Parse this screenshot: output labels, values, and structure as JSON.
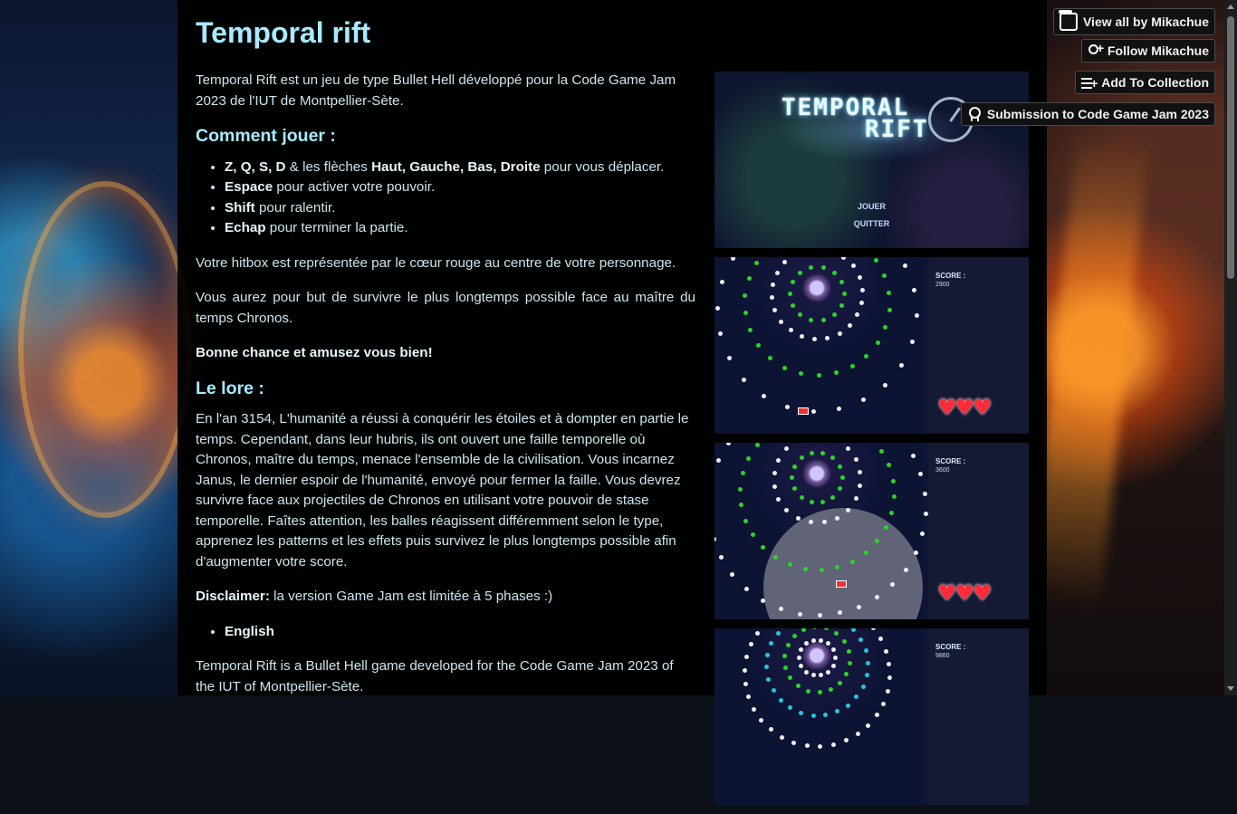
{
  "page": {
    "title": "Temporal rift"
  },
  "header_buttons": {
    "view_all": "View all by Mikachue",
    "follow": "Follow Mikachue",
    "add_collection": "Add To Collection",
    "submission": "Submission to Code Game Jam 2023"
  },
  "description": {
    "intro": "Temporal Rift est un jeu de type Bullet Hell développé pour la Code Game Jam 2023 de l'IUT de Montpellier-Sète.",
    "how_to_heading": "Comment jouer :",
    "controls": [
      {
        "keys": "Z, Q, S, D",
        "sep": " & les flèches ",
        "keys2": "Haut, Gauche, Bas, Droite",
        "rest": "  pour vous déplacer."
      },
      {
        "keys": "Espace",
        "rest": " pour activer votre pouvoir."
      },
      {
        "keys": "Shift",
        "rest": " pour ralentir."
      },
      {
        "keys": "Echap",
        "rest": " pour terminer la partie."
      }
    ],
    "hitbox": "Votre hitbox est représentée par le cœur rouge au centre de votre personnage.",
    "goal": "Vous aurez pour but de survivre le plus longtemps possible face au maître du temps Chronos.",
    "good_luck": "Bonne chance et amusez vous bien!",
    "lore_heading": "Le lore :",
    "lore": "En l'an 3154, L'humanité a réussi à conquérir les étoiles et à dompter en partie le temps. Cependant, dans leur hubris, ils ont ouvert une faille temporelle où Chronos, maître du temps, menace l'ensemble de la civilisation. Vous incarnez Janus, le dernier espoir de l'humanité, envoyé pour fermer la faille. Vous devrez survivre face aux projectiles de Chronos en utilisant votre pouvoir de stase temporelle. Faîtes attention, les balles réagissent différemment selon le type, apprenez les patterns et les effets puis survivez le plus longtemps possible afin d'augmenter votre score.",
    "disclaimer_label": "Disclaimer:",
    "disclaimer_text": " la version Game Jam est limitée à 5 phases :)",
    "english_item": "English",
    "english_intro": "Temporal Rift is a Bullet Hell game developed for the Code Game Jam 2023 of the IUT of Montpellier-Sète."
  },
  "screenshots": {
    "title_screen": {
      "logo_line1": "TEMPORAL",
      "logo_line2": "RIFT",
      "menu_play": "JOUER",
      "menu_quit": "QUITTER"
    },
    "game1": {
      "score_label": "SCORE :",
      "score": "2900",
      "hearts": "♥♥♥"
    },
    "game2": {
      "score_label": "SCORE :",
      "score": "3600",
      "hearts": "♥♥♥"
    },
    "game3": {
      "score_label": "SCORE :",
      "score": "9860"
    }
  },
  "colors": {
    "accent": "#a8eaff",
    "text": "#cde5ee",
    "bullet_green": "#2bd42b",
    "bullet_white": "#eeeeee",
    "bullet_cyan": "#22c6e0",
    "heart": "#ff2b38"
  },
  "icons": {
    "view_all": "itchio-store-icon",
    "follow": "follow-user-icon",
    "add_collection": "add-to-list-icon",
    "submission": "award-badge-icon"
  }
}
